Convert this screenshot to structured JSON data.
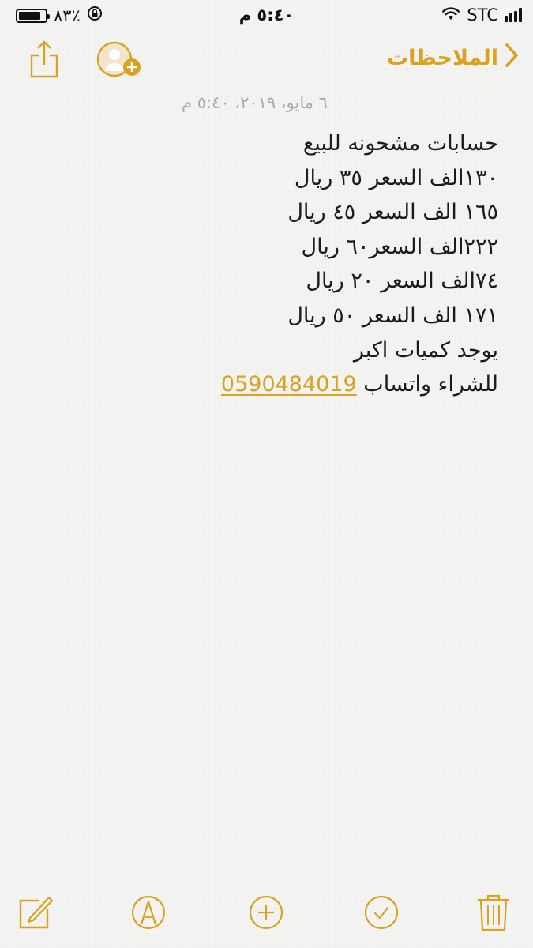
{
  "status_bar": {
    "battery_text": "٨٣٪",
    "time": "٥:٤٠ م",
    "carrier": "STC",
    "battery_level": 0.83
  },
  "nav": {
    "back_label": "الملاحظات",
    "back_icon": "chevron-right-icon",
    "share_icon": "share-icon",
    "add_person_icon": "add-person-icon"
  },
  "note": {
    "date": "٦ مايو، ٢٠١٩، ٥:٤٠ م",
    "lines": [
      "حسابات مشحونه للبيع",
      "١٣٠الف السعر ٣٥ ريال",
      "١٦٥ الف السعر ٤٥ ريال",
      "٢٢٢الف السعر٦٠ ريال",
      "٧٤الف السعر ٢٠ ريال",
      "١٧١ الف السعر ٥٠ ريال",
      "يوجد كميات اكبر"
    ],
    "last_line_text": "للشراء  واتساب ",
    "phone": "0590484019"
  },
  "toolbar": {
    "items": [
      "compose-icon",
      "markup-icon",
      "add-icon",
      "checklist-icon",
      "trash-icon"
    ]
  },
  "colors": {
    "accent": "#d9a21f",
    "background": "#f4f4f2",
    "date_gray": "#a9a9a9"
  }
}
